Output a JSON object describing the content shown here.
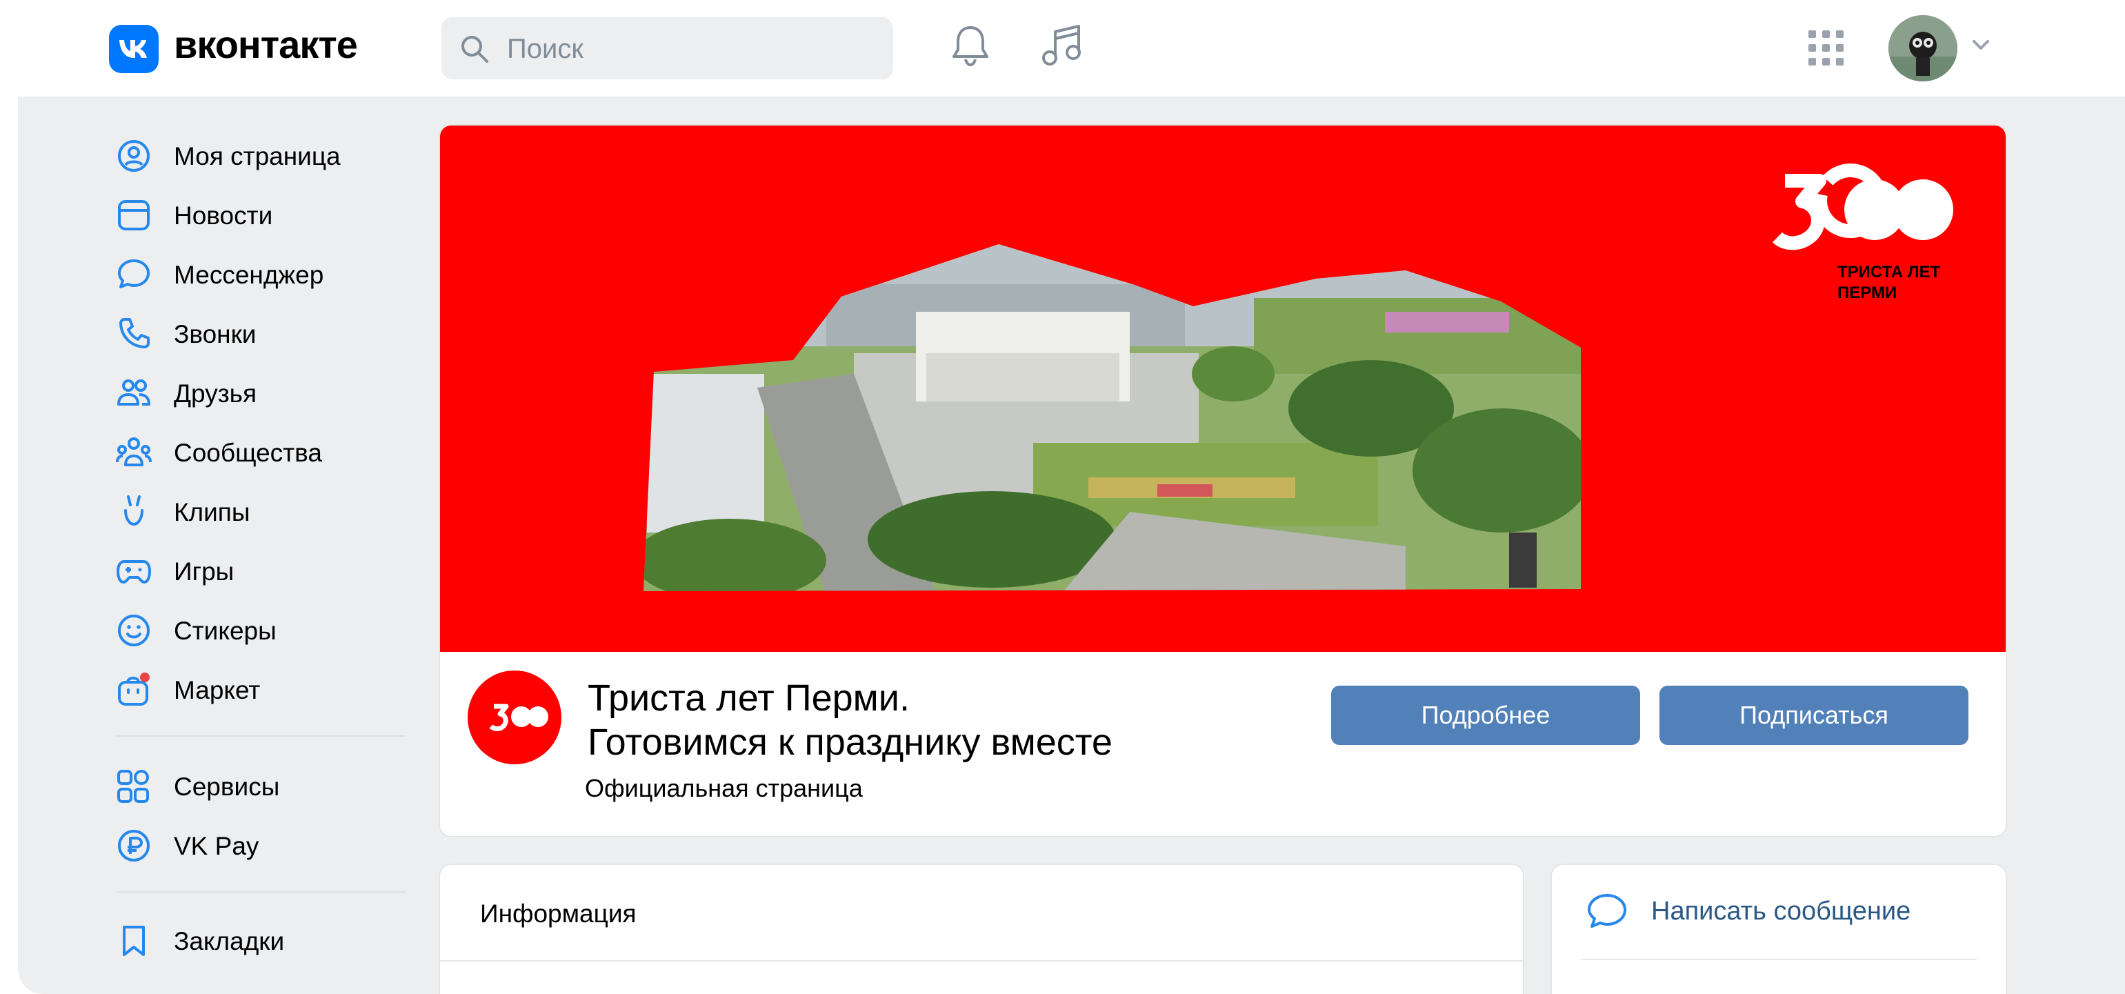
{
  "header": {
    "brand": "вконтакте",
    "search_placeholder": "Поиск"
  },
  "sidebar": {
    "items": [
      {
        "label": "Моя страница"
      },
      {
        "label": "Новости"
      },
      {
        "label": "Мессенджер"
      },
      {
        "label": "Звонки"
      },
      {
        "label": "Друзья"
      },
      {
        "label": "Сообщества"
      },
      {
        "label": "Клипы"
      },
      {
        "label": "Игры"
      },
      {
        "label": "Стикеры"
      },
      {
        "label": "Маркет"
      },
      {
        "label": "Сервисы"
      },
      {
        "label": "VK Pay"
      },
      {
        "label": "Закладки"
      }
    ]
  },
  "cover": {
    "mark_number": "300",
    "mark_caption_1": "ТРИСТА ЛЕТ",
    "mark_caption_2": "ПЕРМИ"
  },
  "group": {
    "title_line1": "Триста лет Перми.",
    "title_line2": "Готовимся к празднику вместе",
    "subtitle": "Официальная страница",
    "more_button": "Подробнее",
    "subscribe_button": "Подписаться"
  },
  "info": {
    "title": "Информация"
  },
  "side_actions": {
    "write_message": "Написать сообщение"
  },
  "colors": {
    "accent": "#0077ff",
    "button": "#5181b8",
    "cover_red": "#ff0000",
    "link": "#2a5885",
    "page_bg": "#edeef0"
  }
}
